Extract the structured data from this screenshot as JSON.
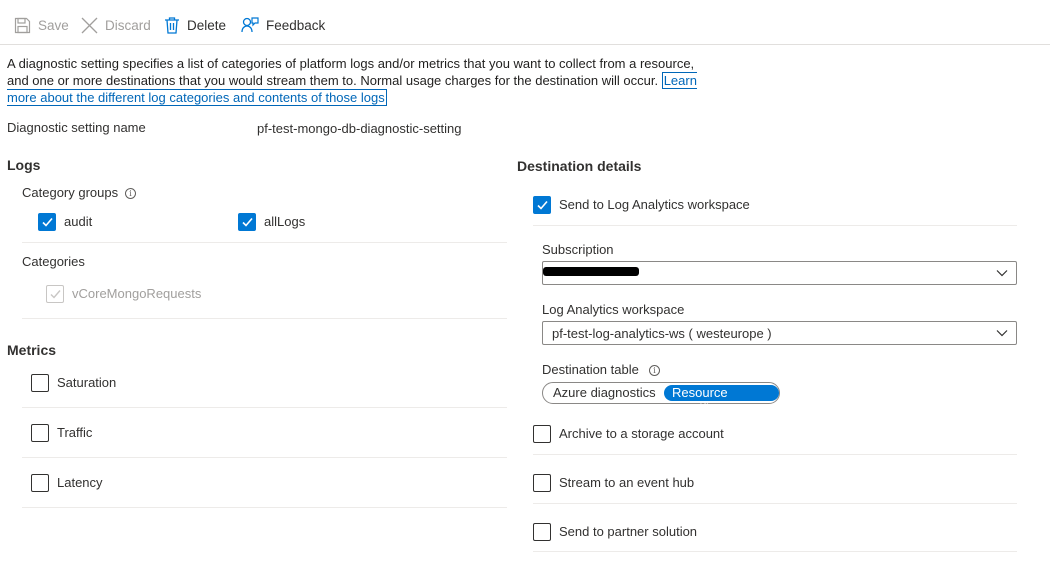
{
  "toolbar": {
    "save": "Save",
    "discard": "Discard",
    "delete": "Delete",
    "feedback": "Feedback"
  },
  "description": {
    "text": "A diagnostic setting specifies a list of categories of platform logs and/or metrics that you want to collect from a resource, and one or more destinations that you would stream them to. Normal usage charges for the destination will occur.",
    "link": "Learn more about the different log categories and contents of those logs"
  },
  "setting_name": {
    "label": "Diagnostic setting name",
    "value": "pf-test-mongo-db-diagnostic-setting"
  },
  "logs": {
    "title": "Logs",
    "category_groups_label": "Category groups",
    "groups": [
      {
        "label": "audit",
        "checked": true
      },
      {
        "label": "allLogs",
        "checked": true
      }
    ],
    "categories_label": "Categories",
    "categories": [
      {
        "label": "vCoreMongoRequests",
        "checked": true,
        "disabled": true
      }
    ]
  },
  "metrics": {
    "title": "Metrics",
    "items": [
      {
        "label": "Saturation",
        "checked": false
      },
      {
        "label": "Traffic",
        "checked": false
      },
      {
        "label": "Latency",
        "checked": false
      }
    ]
  },
  "destination": {
    "title": "Destination details",
    "log_analytics": {
      "label": "Send to Log Analytics workspace",
      "checked": true
    },
    "subscription_label": "Subscription",
    "subscription_value": "",
    "workspace_label": "Log Analytics workspace",
    "workspace_value": "pf-test-log-analytics-ws ( westeurope )",
    "table_label": "Destination table",
    "table_options": [
      "Azure diagnostics",
      "Resource specific"
    ],
    "table_selected": "Resource specific",
    "archive": {
      "label": "Archive to a storage account",
      "checked": false
    },
    "event_hub": {
      "label": "Stream to an event hub",
      "checked": false
    },
    "partner": {
      "label": "Send to partner solution",
      "checked": false
    }
  },
  "colors": {
    "accent": "#0078d4",
    "link": "#0067b8",
    "text": "#323130",
    "disabled": "#a19f9d"
  }
}
